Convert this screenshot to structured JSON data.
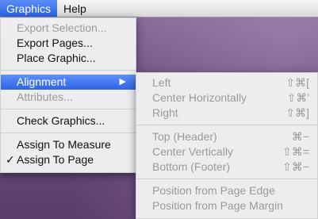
{
  "menubar": {
    "items": [
      {
        "label": "Graphics",
        "active": true
      },
      {
        "label": "Help",
        "active": false
      }
    ]
  },
  "main_menu": {
    "items": [
      {
        "label": "Export Selection...",
        "enabled": false
      },
      {
        "label": "Export Pages...",
        "enabled": true
      },
      {
        "label": "Place Graphic...",
        "enabled": true
      },
      {
        "label": "Alignment",
        "enabled": true,
        "submenu": true,
        "highlighted": true
      },
      {
        "label": "Attributes...",
        "enabled": false
      },
      {
        "label": "Check Graphics...",
        "enabled": true
      },
      {
        "label": "Assign To Measure",
        "enabled": true
      },
      {
        "label": "Assign To Page",
        "enabled": true,
        "checked": true
      }
    ],
    "submenu_arrow": "▶",
    "check_mark": "✓"
  },
  "alignment_submenu": {
    "items": [
      {
        "label": "Left",
        "shortcut": "⇧⌘[",
        "enabled": false
      },
      {
        "label": "Center Horizontally",
        "shortcut": "⇧⌘'",
        "enabled": false
      },
      {
        "label": "Right",
        "shortcut": "⇧⌘]",
        "enabled": false
      },
      {
        "label": "Top (Header)",
        "shortcut": "⌘−",
        "enabled": false
      },
      {
        "label": "Center Vertically",
        "shortcut": "⇧⌘=",
        "enabled": false
      },
      {
        "label": "Bottom (Footer)",
        "shortcut": "⇧⌘−",
        "enabled": false
      },
      {
        "label": "Position from Page Edge",
        "enabled": false
      },
      {
        "label": "Position from Page Margin",
        "enabled": false
      }
    ]
  },
  "colors": {
    "highlight": "#2c64e6",
    "disabled_text": "#9a9a9a",
    "desktop": "#6e5080"
  }
}
